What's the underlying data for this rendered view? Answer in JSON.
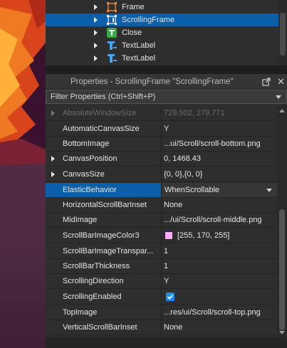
{
  "explorer": {
    "items": [
      {
        "label": "Frame",
        "icon": "frame-icon",
        "selected": false
      },
      {
        "label": "ScrollingFrame",
        "icon": "scrolling-frame-icon",
        "selected": true
      },
      {
        "label": "Close",
        "icon": "text-button-icon",
        "selected": false
      },
      {
        "label": "TextLabel",
        "icon": "text-label-icon",
        "selected": false
      },
      {
        "label": "TextLabel",
        "icon": "text-label-icon",
        "selected": false
      }
    ]
  },
  "properties": {
    "title": "Properties - ScrollingFrame \"ScrollingFrame\"",
    "filter_placeholder": "Filter Properties (Ctrl+Shift+P)",
    "rows": [
      {
        "name": "AbsoluteWindowSize",
        "value": "729.502, 279.771"
      },
      {
        "name": "AutomaticCanvasSize",
        "value": "Y"
      },
      {
        "name": "BottomImage",
        "value": "...ui/Scroll/scroll-bottom.png"
      },
      {
        "name": "CanvasPosition",
        "value": "0, 1468.43"
      },
      {
        "name": "CanvasSize",
        "value": "{0, 0},{0, 0}"
      },
      {
        "name": "ElasticBehavior",
        "value": "WhenScrollable"
      },
      {
        "name": "HorizontalScrollBarInset",
        "value": "None"
      },
      {
        "name": "MidImage",
        "value": ".../ui/Scroll/scroll-middle.png"
      },
      {
        "name": "ScrollBarImageColor3",
        "value": "[255, 170, 255]",
        "color": "#ffaaff"
      },
      {
        "name": "ScrollBarImageTranspar...",
        "value": "1"
      },
      {
        "name": "ScrollBarThickness",
        "value": "1"
      },
      {
        "name": "ScrollingDirection",
        "value": "Y"
      },
      {
        "name": "ScrollingEnabled",
        "value": "true"
      },
      {
        "name": "TopImage",
        "value": "...res/ui/Scroll/scroll-top.png"
      },
      {
        "name": "VerticalScrollBarInset",
        "value": "None"
      }
    ]
  },
  "colors": {
    "selection": "#0b5ea8",
    "accent_checkbox": "#1a8ef0"
  }
}
